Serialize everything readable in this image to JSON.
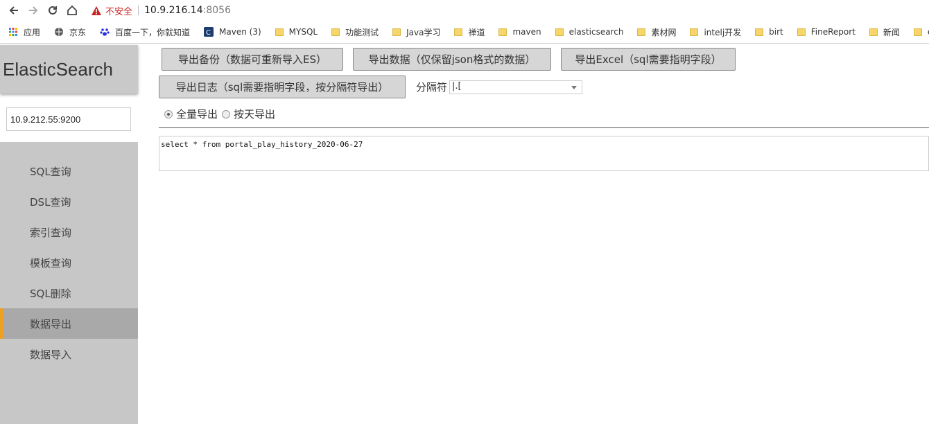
{
  "browser": {
    "warning_text": "不安全",
    "url_host": "10.9.216.14",
    "url_port": ":8056"
  },
  "bookmarks": [
    {
      "label": "应用",
      "icon": "apps-grid-icon"
    },
    {
      "label": "京东",
      "icon": "globe-icon"
    },
    {
      "label": "百度一下，你就知道",
      "icon": "baidu-paw-icon"
    },
    {
      "label": "Maven (3)",
      "icon": "maven-icon"
    },
    {
      "label": "MYSQL",
      "icon": "folder-icon"
    },
    {
      "label": "功能测试",
      "icon": "folder-icon"
    },
    {
      "label": "Java学习",
      "icon": "folder-icon"
    },
    {
      "label": "禅道",
      "icon": "folder-icon"
    },
    {
      "label": "maven",
      "icon": "folder-icon"
    },
    {
      "label": "elasticsearch",
      "icon": "folder-icon"
    },
    {
      "label": "素材网",
      "icon": "folder-icon"
    },
    {
      "label": "intelj开发",
      "icon": "folder-icon"
    },
    {
      "label": "birt",
      "icon": "folder-icon"
    },
    {
      "label": "FineReport",
      "icon": "folder-icon"
    },
    {
      "label": "新闻",
      "icon": "folder-icon"
    },
    {
      "label": "ech",
      "icon": "folder-icon"
    }
  ],
  "sidebar": {
    "brand": "ElasticSearch",
    "host_value": "10.9.212.55:9200",
    "items": [
      {
        "label": "SQL查询"
      },
      {
        "label": "DSL查询"
      },
      {
        "label": "索引查询"
      },
      {
        "label": "模板查询"
      },
      {
        "label": "SQL删除"
      },
      {
        "label": "数据导出"
      },
      {
        "label": "数据导入"
      }
    ]
  },
  "main": {
    "buttons": {
      "backup": "导出备份（数据可重新导入ES）",
      "export_json": "导出数据（仅保留json格式的数据）",
      "export_excel": "导出Excel（sql需要指明字段）",
      "export_log": "导出日志（sql需要指明字段，按分隔符导出）"
    },
    "separator_label": "分隔符",
    "separator_value": "|.[",
    "radios": {
      "full": "全量导出",
      "daily": "按天导出"
    },
    "sql_text": "select * from portal_play_history_2020-06-27"
  }
}
